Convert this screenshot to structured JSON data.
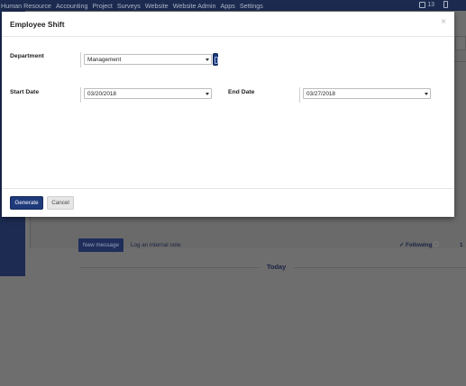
{
  "navbar": {
    "menu": [
      "Human Resource",
      "Accounting",
      "Project",
      "Surveys",
      "Website",
      "Website Admin",
      "Apps",
      "Settings"
    ],
    "notification_count": "13"
  },
  "background": {
    "new_message_label": "New message",
    "log_note_label": "Log an internal note",
    "following_label": "Following",
    "followers_count": "1",
    "today_label": "Today"
  },
  "modal": {
    "title": "Employee Shift",
    "close_glyph": "×",
    "department_label": "Department",
    "department_value": "Management",
    "start_date_label": "Start Date",
    "start_date_value": "03/20/2018",
    "end_date_label": "End Date",
    "end_date_value": "03/27/2018",
    "generate_label": "Generate",
    "cancel_label": "Cancel"
  },
  "colors": {
    "navbar": "#1b2a4e",
    "primary": "#1e3a7b",
    "overlay": "#6e6e6e"
  },
  "icons": [
    "chat-icon",
    "phone-icon",
    "close-icon",
    "caret-down-icon",
    "external-link-icon",
    "follow-icon"
  ]
}
